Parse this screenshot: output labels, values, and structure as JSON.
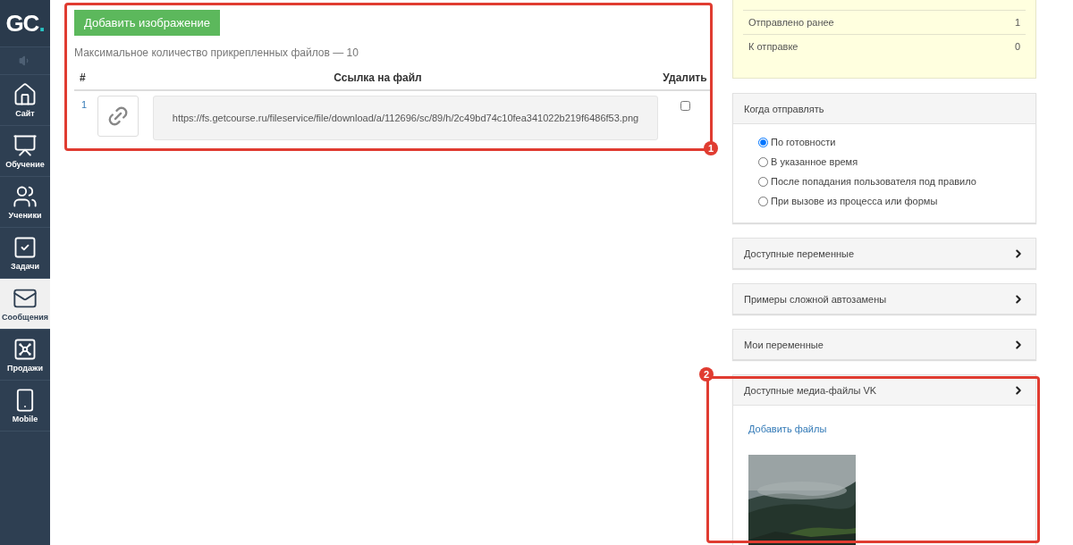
{
  "sidebar": {
    "logo": {
      "text": "GC",
      "dot": "."
    },
    "items": [
      {
        "label": "Сайт",
        "selected": false
      },
      {
        "label": "Обучение",
        "selected": false
      },
      {
        "label": "Ученики",
        "selected": false
      },
      {
        "label": "Задачи",
        "selected": false
      },
      {
        "label": "Сообщения",
        "selected": true
      },
      {
        "label": "Продажи",
        "selected": false
      },
      {
        "label": "Mobile",
        "selected": false
      }
    ]
  },
  "attachments": {
    "add_button": "Добавить изображение",
    "limit_note": "Максимальное количество прикрепленных файлов — 10",
    "columns": [
      "#",
      "Ссылка на файл",
      "Удалить"
    ],
    "rows": [
      {
        "number": "1",
        "url": "https://fs.getcourse.ru/fileservice/file/download/a/112696/sc/89/h/2c49bd74c10fea341022b219f6486f53.png",
        "checked": false
      }
    ]
  },
  "stats": [
    {
      "label": "Отправлено ранее",
      "value": "1"
    },
    {
      "label": "К отправке",
      "value": "0"
    }
  ],
  "when_to_send": {
    "title": "Когда отправлять",
    "options": [
      {
        "label": "По готовности",
        "selected": true
      },
      {
        "label": "В указанное время",
        "selected": false
      },
      {
        "label": "После попадания пользователя под правило",
        "selected": false
      },
      {
        "label": "При вызове из процесса или формы",
        "selected": false
      }
    ]
  },
  "panels": [
    {
      "title": "Доступные переменные",
      "expanded": false
    },
    {
      "title": "Примеры сложной автозамены",
      "expanded": false
    },
    {
      "title": "Мои переменные",
      "expanded": false
    },
    {
      "title": "Доступные медиа-файлы VK",
      "expanded": true,
      "link": "Добавить файлы"
    }
  ],
  "annotations": [
    {
      "label": "1"
    },
    {
      "label": "2"
    }
  ]
}
